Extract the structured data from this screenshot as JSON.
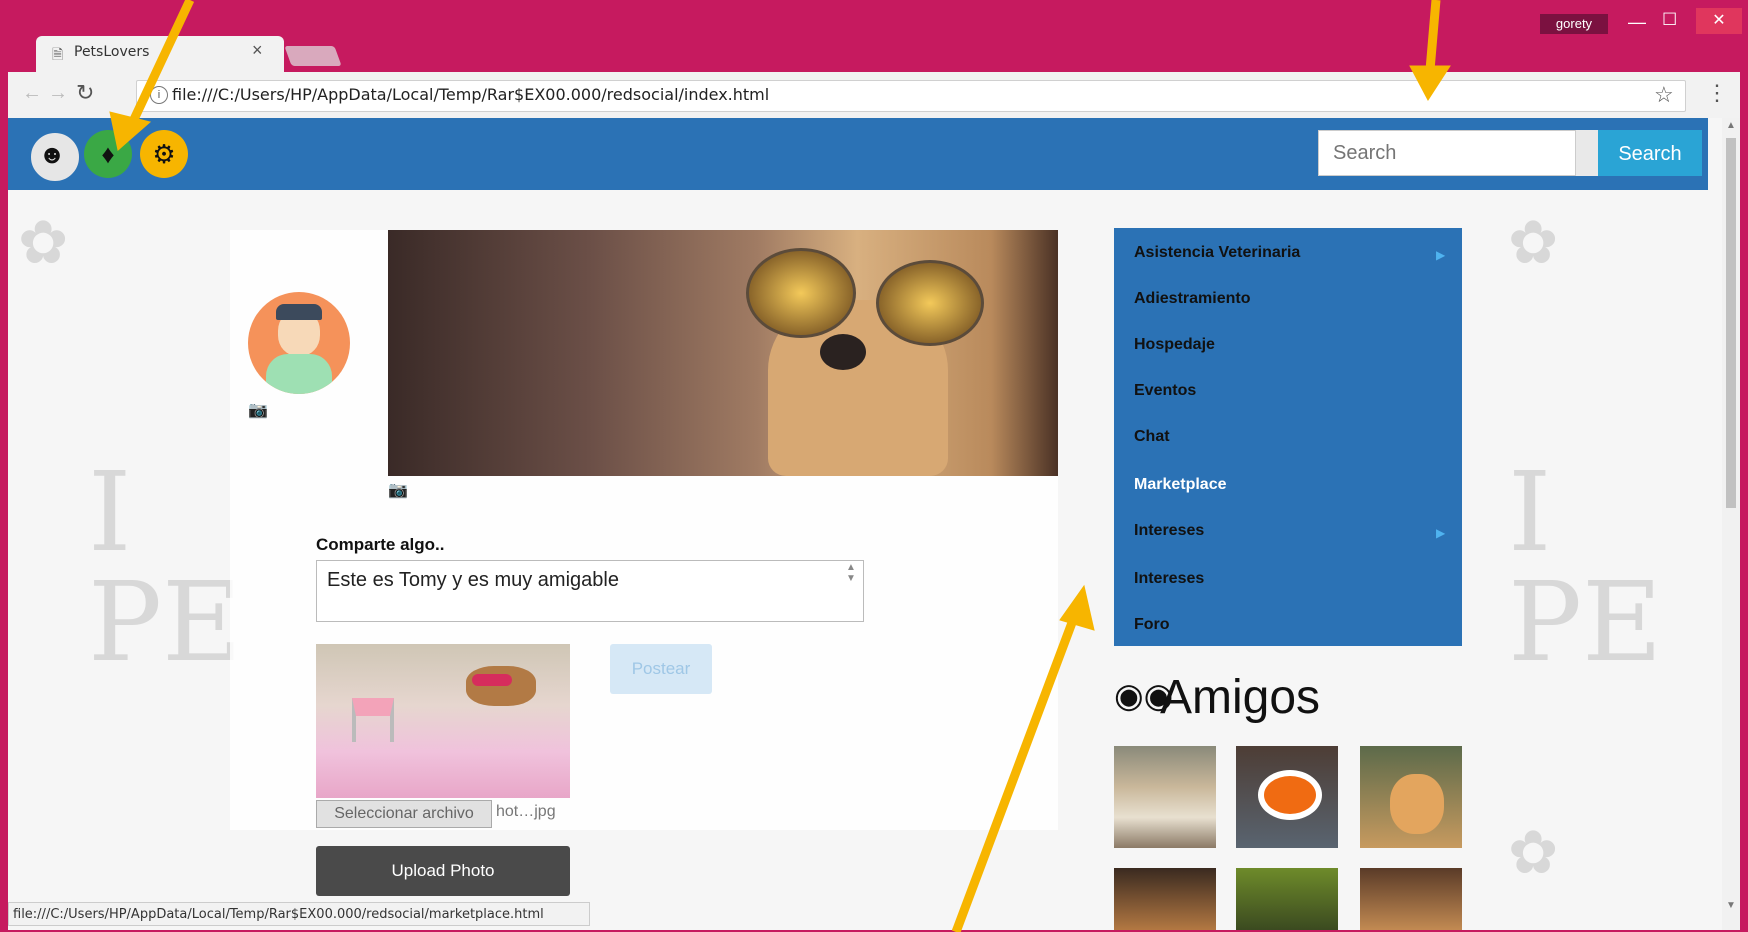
{
  "browser": {
    "tab_title": "PetsLovers",
    "tab_close": "×",
    "user_name": "gorety",
    "url": "file:///C:/Users/HP/AppData/Local/Temp/Rar$EX00.000/redsocial/index.html",
    "status_url": "file:///C:/Users/HP/AppData/Local/Temp/Rar$EX00.000/redsocial/marketplace.html"
  },
  "navbar": {
    "icons": [
      "user-icon",
      "bell-icon",
      "gear-icon"
    ],
    "search_placeholder": "Search",
    "search_button": "Search",
    "color": "#2b72b5"
  },
  "profile": {
    "share_label": "Comparte algo..",
    "share_text": "Este es Tomy y es muy amigable",
    "file_button": "Seleccionar archivo",
    "file_name": "hot…jpg",
    "post_button": "Postear",
    "upload_button": "Upload Photo"
  },
  "menu": {
    "items": [
      {
        "label": "Asistencia Veterinaria",
        "submenu": true
      },
      {
        "label": "Adiestramiento",
        "submenu": false
      },
      {
        "label": "Hospedaje",
        "submenu": false
      },
      {
        "label": "Eventos",
        "submenu": false
      },
      {
        "label": "Chat",
        "submenu": false
      },
      {
        "label": "Marketplace",
        "submenu": false,
        "hover": true
      },
      {
        "label": "Intereses",
        "submenu": true
      },
      {
        "label": "Intereses",
        "submenu": false
      },
      {
        "label": "Foro",
        "submenu": false
      }
    ]
  },
  "friends": {
    "title": "Amigos",
    "icon": "users-icon"
  }
}
